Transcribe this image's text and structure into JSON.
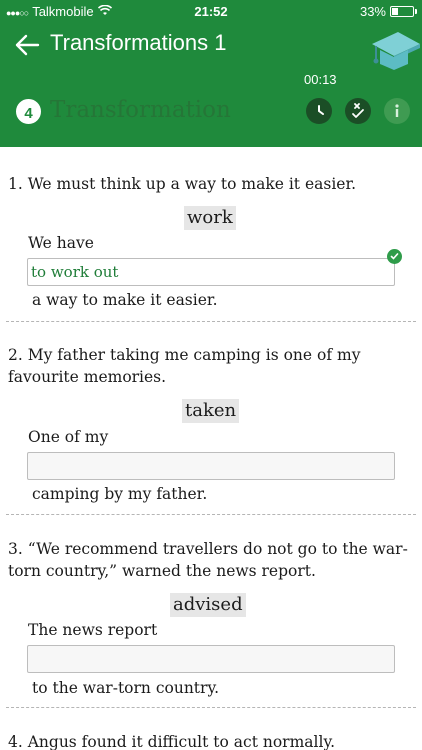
{
  "status_bar": {
    "carrier": "Talkmobile",
    "time": "21:52",
    "battery": "33%",
    "battery_level": 0.33
  },
  "header": {
    "title": "Transformations 1",
    "timer": "00:13",
    "step_number": "4",
    "section_title": "Transformation",
    "icons": [
      "back-arrow-icon",
      "graduation-cap-icon",
      "clock-icon",
      "check-answers-icon",
      "info-icon"
    ]
  },
  "questions": [
    {
      "text": "1. We must think up a way to make it easier.",
      "keyword": "work",
      "prompt": "We have",
      "answer_value": "to work out",
      "ending": "a way to make it easier.",
      "status": "correct"
    },
    {
      "text_line1": "2. My father taking me camping is one of my",
      "text_line2": "favourite memories.",
      "keyword": "taken",
      "prompt": "One of my",
      "answer_value": "",
      "ending": "camping by my father."
    },
    {
      "text_line1": "3. “We recommend travellers do not go to the war-",
      "text_line2": "torn country,” warned the news report.",
      "keyword": "advised",
      "prompt": "The news report",
      "answer_value": "",
      "ending": "to the war-torn country."
    },
    {
      "text": "4. Angus found it difficult to act normally."
    }
  ],
  "colors": {
    "header_green": "#1f8a3c",
    "correct_green": "#2f9c4a",
    "icon_dark": "#1b4e26"
  }
}
